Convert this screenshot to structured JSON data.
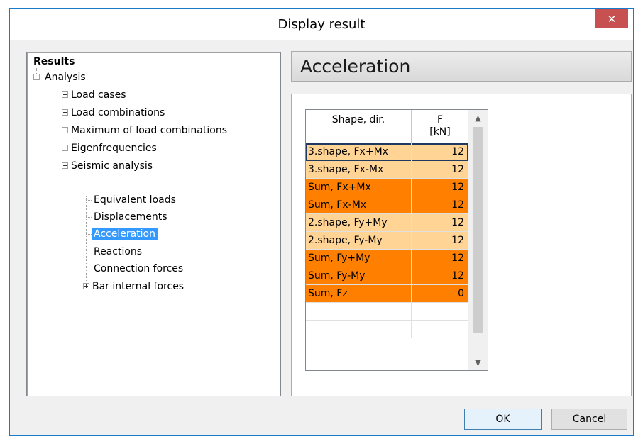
{
  "window": {
    "title": "Display result",
    "close_glyph": "✕"
  },
  "tree": {
    "root_label": "Results",
    "nodes": [
      {
        "label": "Analysis",
        "expander": "minus"
      },
      {
        "label": "Load cases",
        "expander": "plus"
      },
      {
        "label": "Load combinations",
        "expander": "plus"
      },
      {
        "label": "Maximum of load combinations",
        "expander": "plus"
      },
      {
        "label": "Eigenfrequencies",
        "expander": "plus"
      },
      {
        "label": "Seismic analysis",
        "expander": "minus"
      },
      {
        "label": "Equivalent loads",
        "expander": "none"
      },
      {
        "label": "Displacements",
        "expander": "none"
      },
      {
        "label": "Acceleration",
        "expander": "none",
        "selected": true
      },
      {
        "label": "Reactions",
        "expander": "none"
      },
      {
        "label": "Connection forces",
        "expander": "none"
      },
      {
        "label": "Bar internal forces",
        "expander": "plus"
      }
    ]
  },
  "panel": {
    "header": "Acceleration"
  },
  "table": {
    "columns": [
      "Shape, dir.",
      "F",
      "[kN]"
    ],
    "rows": [
      {
        "shape": "3.shape, Fx+Mx",
        "f": "12",
        "color": "#ffd495"
      },
      {
        "shape": "3.shape, Fx-Mx",
        "f": "12",
        "color": "#ffd495"
      },
      {
        "shape": "Sum, Fx+Mx",
        "f": "12",
        "color": "#ff8000"
      },
      {
        "shape": "Sum, Fx-Mx",
        "f": "12",
        "color": "#ff8000"
      },
      {
        "shape": "2.shape, Fy+My",
        "f": "12",
        "color": "#ffd495"
      },
      {
        "shape": "2.shape, Fy-My",
        "f": "12",
        "color": "#ffd495"
      },
      {
        "shape": "Sum, Fy+My",
        "f": "12",
        "color": "#ff8000"
      },
      {
        "shape": "Sum, Fy-My",
        "f": "12",
        "color": "#ff8000"
      },
      {
        "shape": "Sum, Fz",
        "f": "0",
        "color": "#ff8000"
      },
      {
        "shape": "",
        "f": "",
        "color": "#ffffff"
      },
      {
        "shape": "",
        "f": "",
        "color": "#ffffff"
      }
    ],
    "scroll_up_glyph": "▲",
    "scroll_down_glyph": "▼"
  },
  "buttons": {
    "ok": "OK",
    "cancel": "Cancel"
  },
  "colors": {
    "accent": "#1979ca",
    "selection": "#3399ff",
    "close_red": "#c75050",
    "light_orange": "#ffd495",
    "dark_orange": "#ff8000"
  }
}
